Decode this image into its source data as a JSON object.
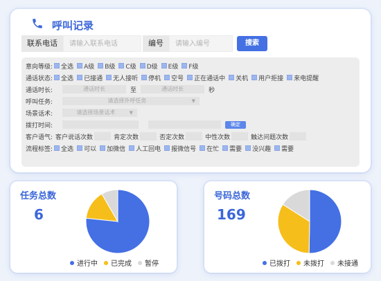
{
  "header": {
    "title": "呼叫记录"
  },
  "search": {
    "phone_label": "联系电话",
    "phone_placeholder": "请输入联系电话",
    "id_label": "编号",
    "id_placeholder": "请输入编号",
    "button": "搜索"
  },
  "filters": {
    "intent": {
      "label": "意向等级:",
      "options": [
        "全选",
        "A级",
        "B级",
        "C级",
        "D级",
        "E级",
        "F级"
      ]
    },
    "call_status": {
      "label": "通话状态:",
      "options": [
        "全选",
        "已接通",
        "无人接听",
        "停机",
        "空号",
        "正在通话中",
        "关机",
        "用户拒接",
        "来电提醒"
      ]
    },
    "duration": {
      "label": "通话时长:",
      "placeholder": "通话时长",
      "to": "至",
      "unit": "秒"
    },
    "task": {
      "label": "呼叫任务:",
      "placeholder": "请选择外呼任务"
    },
    "script": {
      "label": "场景话术:",
      "placeholder": "请选择场景话术"
    },
    "dial_time": {
      "label": "拨打时间:",
      "confirm": "确定"
    },
    "customer_speech": {
      "label": "客户语气:",
      "fields": [
        "客户说话次数",
        "肯定次数",
        "否定次数",
        "中性次数",
        "触达问题次数"
      ]
    },
    "flow_tags": {
      "label": "流程标签:",
      "options": [
        "全选",
        "可以",
        "加微信",
        "人工回电",
        "报微信号",
        "在忙",
        "需要",
        "没兴趣",
        "需要"
      ]
    }
  },
  "task_stats": {
    "title": "任务总数",
    "value": "6",
    "legend": [
      "进行中",
      "已完成",
      "暂停"
    ],
    "chart_data": {
      "type": "pie",
      "labels": [
        "进行中",
        "已完成",
        "暂停"
      ],
      "values": [
        4.6,
        0.9,
        0.5
      ],
      "colors": [
        "#4470e4",
        "#f6be1a",
        "#d9d9d9"
      ]
    }
  },
  "number_stats": {
    "title": "号码总数",
    "value": "169",
    "legend": [
      "已拨打",
      "未拨打",
      "未接通"
    ],
    "chart_data": {
      "type": "pie",
      "labels": [
        "已拨打",
        "未拨打",
        "未接通"
      ],
      "values": [
        85,
        57,
        27
      ],
      "colors": [
        "#4470e4",
        "#f6be1a",
        "#d9d9d9"
      ]
    }
  }
}
